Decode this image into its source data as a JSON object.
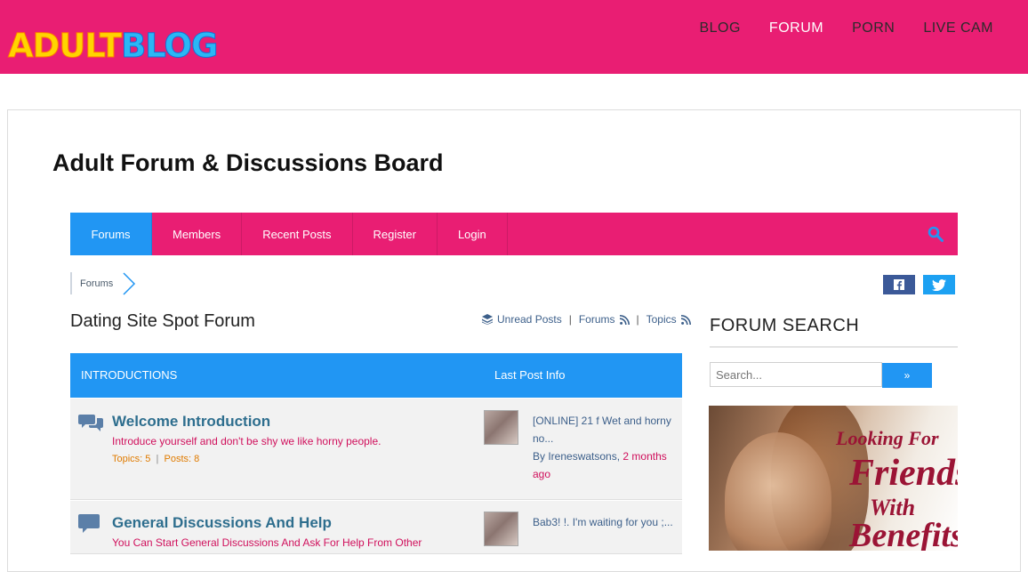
{
  "header": {
    "logo_part1": "ADULT",
    "logo_part2": "BLOG",
    "nav": [
      "BLOG",
      "FORUM",
      "PORN",
      "LIVE CAM"
    ],
    "active_nav": "FORUM",
    "bg_color": "#e91e73"
  },
  "page_title": "Adult Forum & Discussions Board",
  "forum_nav": {
    "tabs": [
      "Forums",
      "Members",
      "Recent Posts",
      "Register",
      "Login"
    ],
    "active_tab": "Forums",
    "search_icon": "search-icon"
  },
  "breadcrumb": {
    "item": "Forums"
  },
  "social": {
    "icons": [
      "facebook-icon",
      "twitter-icon"
    ]
  },
  "forum": {
    "name": "Dating Site Spot Forum",
    "links": {
      "unread": "Unread Posts",
      "forums": "Forums",
      "topics": "Topics"
    },
    "header": {
      "col1": "INTRODUCTIONS",
      "col2": "Last Post Info"
    },
    "rows": [
      {
        "title": "Welcome Introduction",
        "description": "Introduce yourself and don't be shy we like horny people.",
        "topics": "Topics: 5",
        "posts": "Posts: 8",
        "last_post": "[ONLINE] 21 f Wet and horny no...",
        "by": "By Ireneswatsons,",
        "ago": "2 months ago"
      },
      {
        "title": "General Discussions And Help",
        "description": "You Can Start General Discussions And Ask For Help From Other",
        "last_post": "Bab3! !. I'm waiting for you ;..."
      }
    ]
  },
  "sidebar": {
    "title": "FORUM SEARCH",
    "search_placeholder": "Search...",
    "search_button": "»",
    "ad": {
      "line1": "Looking For",
      "line2": "Friends",
      "line3": "With",
      "line4": "Benefits"
    }
  }
}
